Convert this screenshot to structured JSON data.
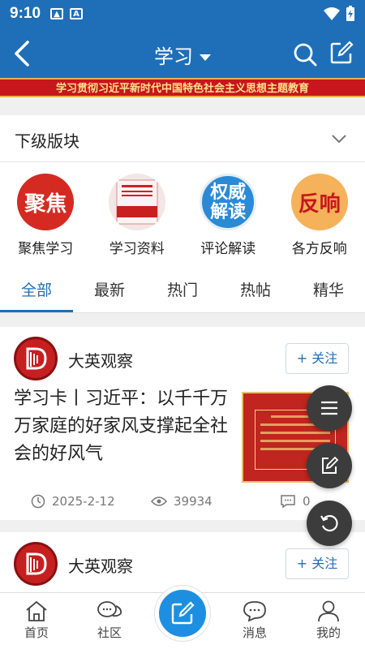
{
  "status": {
    "time": "9:10"
  },
  "header": {
    "title": "学习"
  },
  "banner": {
    "text": "学习贯彻习近平新时代中国特色社会主义思想主题教育"
  },
  "subsection": {
    "title": "下级版块"
  },
  "categories": [
    {
      "label": "聚焦学习",
      "badge": "聚焦",
      "color": "#d42a22"
    },
    {
      "label": "学习资料",
      "badge": "",
      "color": "#f3e6e6"
    },
    {
      "label": "评论解读",
      "badge": "权威解读",
      "color": "#2a8ad6"
    },
    {
      "label": "各方反响",
      "badge": "反响",
      "color": "#f08a2a"
    }
  ],
  "tabs": [
    "全部",
    "最新",
    "热门",
    "热帖",
    "精华"
  ],
  "posts": [
    {
      "author": "大英观察",
      "follow": "+ 关注",
      "title": "学习卡丨习近平：以千千万万家庭的好家风支撑起全社会的好风气",
      "date": "2025-2-12",
      "views": "39934",
      "comments": "0"
    },
    {
      "author": "大英观察",
      "follow": "+ 关注"
    }
  ],
  "nav": {
    "home": "首页",
    "community": "社区",
    "messages": "消息",
    "mine": "我的"
  }
}
